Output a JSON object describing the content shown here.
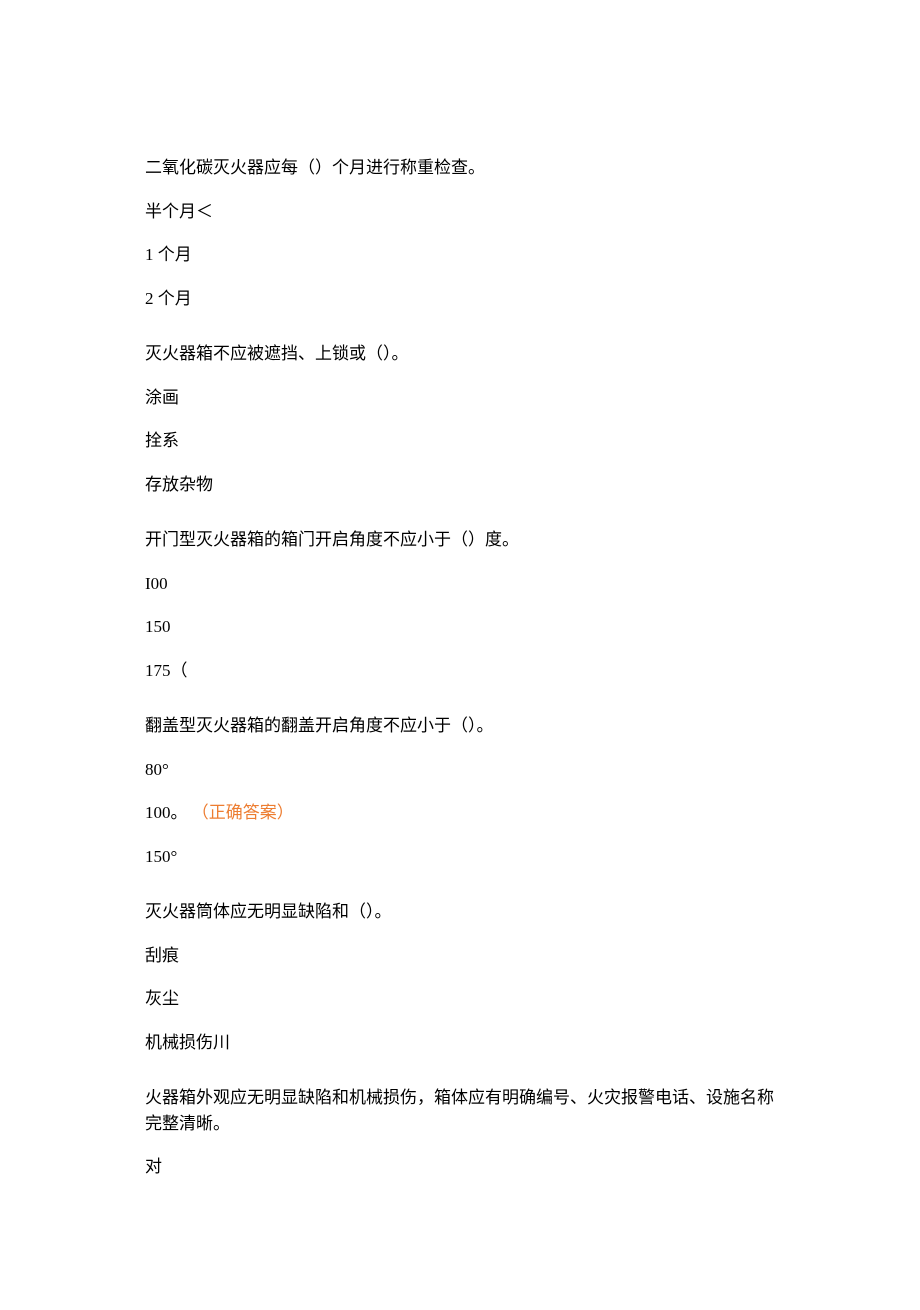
{
  "questions": [
    {
      "stem": "二氧化碳灭火器应每（）个月进行称重检查。",
      "options": [
        {
          "text": "半个月＜",
          "correct": false
        },
        {
          "text": "1 个月",
          "correct": false
        },
        {
          "text": "2 个月",
          "correct": false
        }
      ]
    },
    {
      "stem": "灭火器箱不应被遮挡、上锁或（）。",
      "options": [
        {
          "text": "涂画",
          "correct": false
        },
        {
          "text": "拴系",
          "correct": false
        },
        {
          "text": "存放杂物",
          "correct": false
        }
      ]
    },
    {
      "stem": "开门型灭火器箱的箱门开启角度不应小于（）度。",
      "options": [
        {
          "text": "I00",
          "correct": false
        },
        {
          "text": "150",
          "correct": false
        },
        {
          "text": "175（",
          "correct": false
        }
      ]
    },
    {
      "stem": "翻盖型灭火器箱的翻盖开启角度不应小于（）。",
      "options": [
        {
          "text": "80°",
          "correct": false
        },
        {
          "text": "100。",
          "correct": true,
          "correct_label": "（正确答案）"
        },
        {
          "text": "150°",
          "correct": false
        }
      ]
    },
    {
      "stem": "灭火器筒体应无明显缺陷和（）。",
      "options": [
        {
          "text": "刮痕",
          "correct": false
        },
        {
          "text": "灰尘",
          "correct": false
        },
        {
          "text": "机械损伤川",
          "correct": false
        }
      ]
    },
    {
      "stem": "火器箱外观应无明显缺陷和机械损伤，箱体应有明确编号、火灾报警电话、设施名称完整清晰。",
      "options": [
        {
          "text": "对",
          "correct": false
        }
      ]
    }
  ]
}
